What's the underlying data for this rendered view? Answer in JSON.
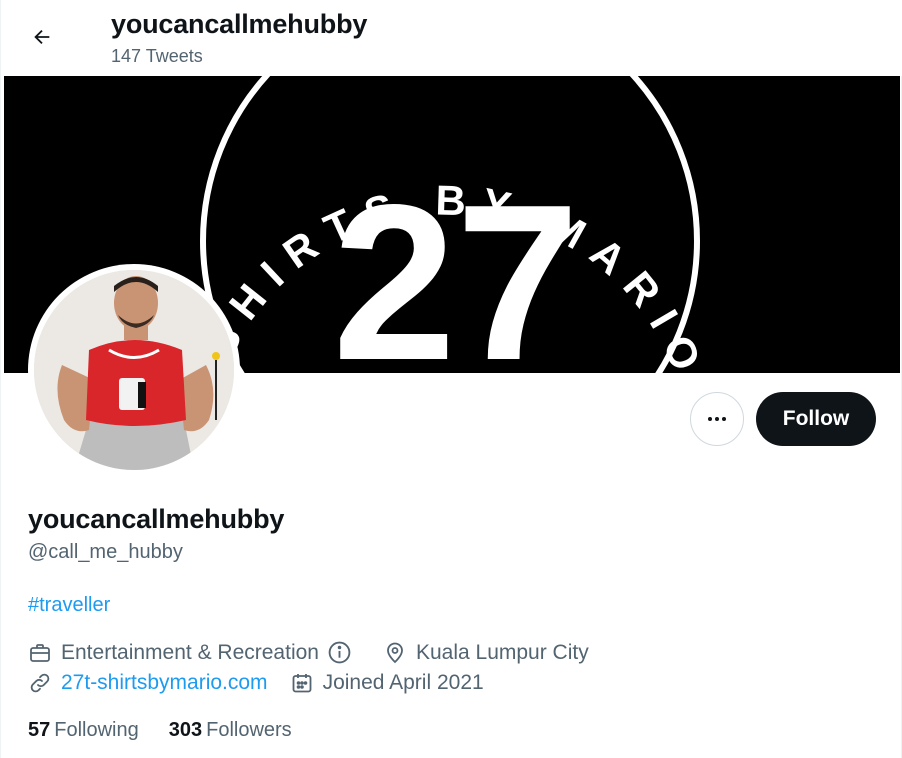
{
  "header": {
    "title": "youcancallmehubby",
    "tweet_count": "147 Tweets",
    "back_icon": "arrow-left-icon"
  },
  "banner": {
    "number": "27",
    "ring_text": "T-SHIRTS BY MARIO",
    "background": "#000000",
    "foreground": "#ffffff"
  },
  "actions": {
    "more_icon": "more-horizontal-icon",
    "follow_label": "Follow"
  },
  "profile": {
    "display_name": "youcancallmehubby",
    "handle": "@call_me_hubby",
    "bio": "#traveller",
    "category": "Entertainment & Recreation",
    "location": "Kuala Lumpur City",
    "website": "27t-shirtsbymario.com",
    "joined": "Joined April 2021"
  },
  "stats": {
    "following_count": "57",
    "following_label": "Following",
    "followers_count": "303",
    "followers_label": "Followers"
  },
  "colors": {
    "text_primary": "#0f1419",
    "text_secondary": "#536471",
    "link": "#1d9bf0",
    "button_dark": "#0f1419"
  }
}
